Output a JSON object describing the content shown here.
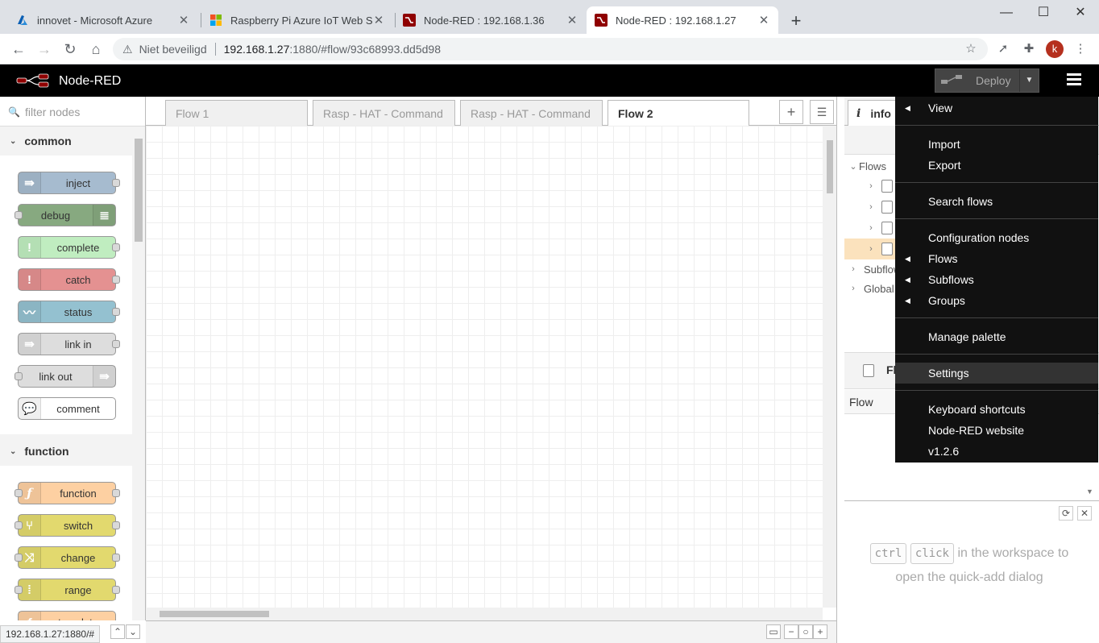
{
  "browser": {
    "tabs": [
      {
        "title": "innovet - Microsoft Azure"
      },
      {
        "title": "Raspberry Pi Azure IoT Web Simulator"
      },
      {
        "title": "Node-RED : 192.168.1.36"
      },
      {
        "title": "Node-RED : 192.168.1.27"
      }
    ],
    "new_tab": "+",
    "address": {
      "security": "Niet beveiligd",
      "host": "192.168.1.27",
      "path": ":1880/#flow/93c68993.dd5d98"
    },
    "status_url": "192.168.1.27:1880/#",
    "profile_initial": "k"
  },
  "app": {
    "title": "Node-RED",
    "deploy_label": "Deploy"
  },
  "palette": {
    "filter_placeholder": "filter nodes",
    "categories": [
      {
        "name": "common",
        "nodes": [
          "inject",
          "debug",
          "complete",
          "catch",
          "status",
          "link in",
          "link out",
          "comment"
        ]
      },
      {
        "name": "function",
        "nodes": [
          "function",
          "switch",
          "change",
          "range",
          "template"
        ]
      }
    ],
    "colors": {
      "inject": "#a6bbcf",
      "debug": "#87a980",
      "complete": "#c0edc0",
      "catch": "#e49191",
      "status": "#94c1d0",
      "link": "#dddddd",
      "comment": "#ffffff",
      "function": "#fdd0a2",
      "switch": "#e2d96e",
      "change": "#e2d96e",
      "range": "#e2d96e",
      "template": "#fdd0a2"
    }
  },
  "workspace": {
    "tabs": [
      "Flow 1",
      "Rasp - HAT - Command",
      "Rasp - HAT - Command",
      "Flow 2"
    ],
    "active_tab": "Flow 2"
  },
  "sidebar": {
    "tab_label": "info",
    "tree": {
      "flows": "Flows",
      "subflows": "Subflows",
      "global": "Global"
    },
    "section_title": "Fl",
    "flow_row_label": "Flow",
    "quickadd": {
      "key1": "ctrl",
      "key2": "click",
      "text1": "in the workspace to",
      "text2": "open the quick-add dialog"
    }
  },
  "menu": {
    "items": {
      "view": "View",
      "import": "Import",
      "export": "Export",
      "search": "Search flows",
      "config": "Configuration nodes",
      "flows": "Flows",
      "subflows": "Subflows",
      "groups": "Groups",
      "palette": "Manage palette",
      "settings": "Settings",
      "shortcuts": "Keyboard shortcuts",
      "website": "Node-RED website",
      "version": "v1.2.6"
    },
    "selected": "Settings"
  }
}
